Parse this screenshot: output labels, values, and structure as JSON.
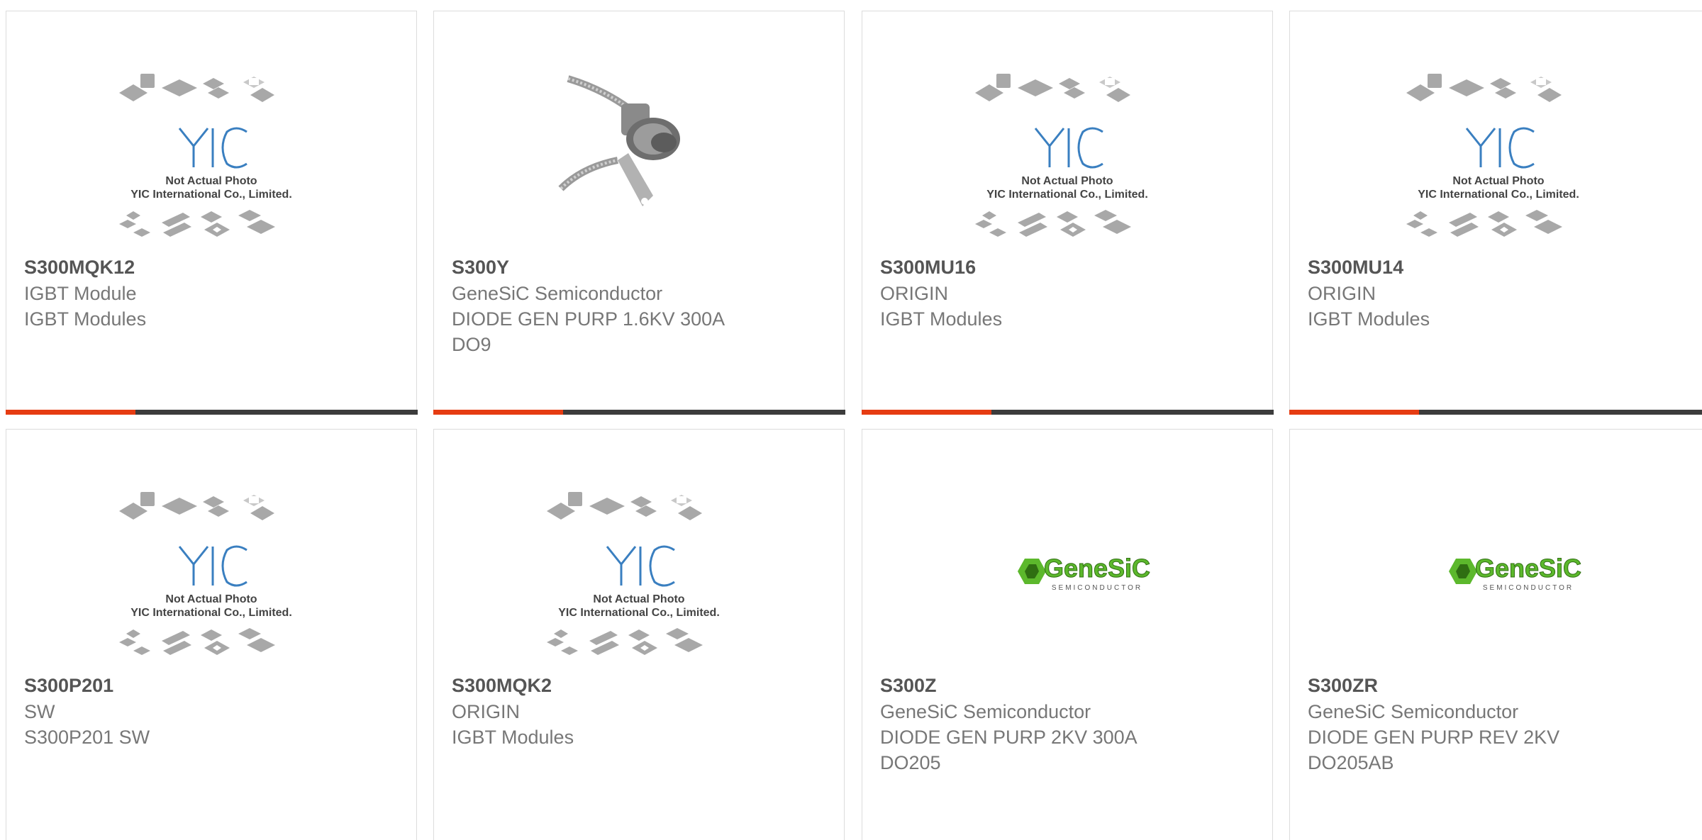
{
  "placeholder_image": {
    "line1": "Not Actual Photo",
    "line2": "YIC International Co., Limited.",
    "logo": "YIC"
  },
  "genesic_logo": {
    "brand": "GeneSiC",
    "sub": "SEMICONDUCTOR",
    "color": "#5cb82c"
  },
  "accent_color": "#e63c12",
  "products": [
    {
      "part": "S300MQK12",
      "line1": "IGBT Module",
      "line2": "IGBT Modules",
      "line3": "",
      "image": "yic-placeholder"
    },
    {
      "part": "S300Y",
      "line1": "GeneSiC Semiconductor",
      "line2": "DIODE GEN PURP 1.6KV 300A",
      "line3": "DO9",
      "image": "stud-diode-photo"
    },
    {
      "part": "S300MU16",
      "line1": "ORIGIN",
      "line2": "IGBT Modules",
      "line3": "",
      "image": "yic-placeholder"
    },
    {
      "part": "S300MU14",
      "line1": "ORIGIN",
      "line2": "IGBT Modules",
      "line3": "",
      "image": "yic-placeholder"
    },
    {
      "part": "S300P201",
      "line1": "SW",
      "line2": "S300P201 SW",
      "line3": "",
      "image": "yic-placeholder"
    },
    {
      "part": "S300MQK2",
      "line1": "ORIGIN",
      "line2": "IGBT Modules",
      "line3": "",
      "image": "yic-placeholder"
    },
    {
      "part": "S300Z",
      "line1": "GeneSiC Semiconductor",
      "line2": "DIODE GEN PURP 2KV 300A",
      "line3": "DO205",
      "image": "genesic-logo"
    },
    {
      "part": "S300ZR",
      "line1": "GeneSiC Semiconductor",
      "line2": "DIODE GEN PURP REV 2KV",
      "line3": "DO205AB",
      "image": "genesic-logo"
    }
  ]
}
